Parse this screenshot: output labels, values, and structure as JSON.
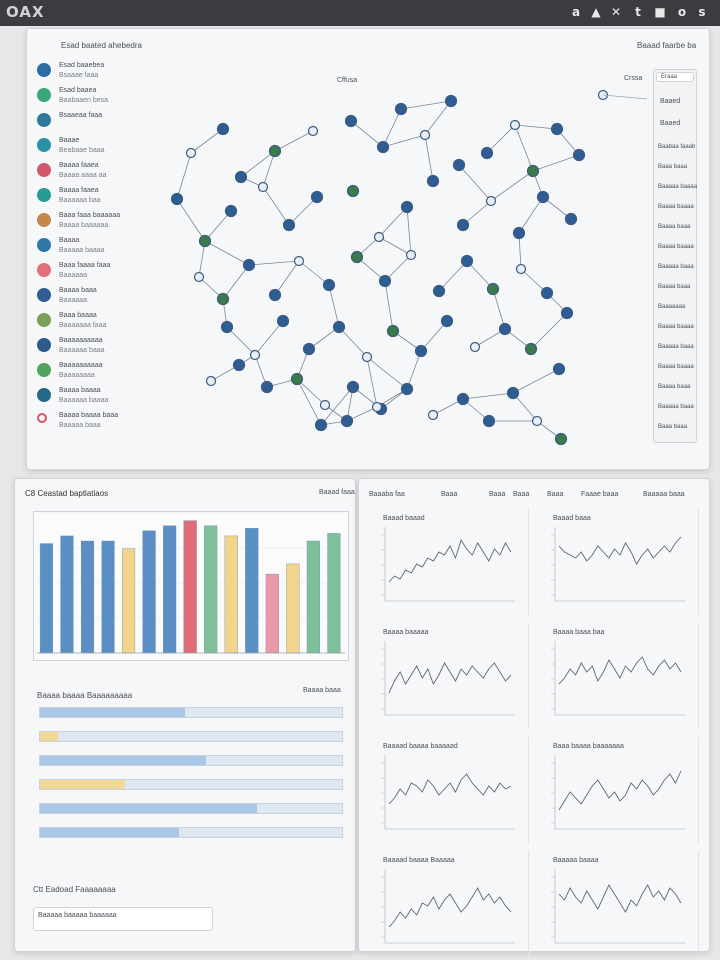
{
  "app": {
    "logo": "OAX",
    "toolbar_icons": [
      "a-icon",
      "pin-icon",
      "bolt-icon",
      "tree-icon",
      "square-icon",
      "circle-icon",
      "download-icon"
    ]
  },
  "network_panel": {
    "sidebar_title": "Esad baated ahebedra",
    "header_right": "Baaad faarbe ba",
    "graph_label": "Cffusa",
    "legend_items": [
      {
        "label": "Esad baaebea",
        "sub": "Bsaaae faaa",
        "color": "#2e6da4"
      },
      {
        "label": "Esad baaea",
        "sub": "Baabaaen besa",
        "color": "#3aa77a"
      },
      {
        "label": "Bsaaeaa faaa",
        "sub": "",
        "color": "#2e7a99"
      },
      {
        "label": "Baaae",
        "sub": "Beabaae baaa",
        "color": "#2a92a8"
      },
      {
        "label": "Baaaa faaea",
        "sub": "Baaaa aaaa aa",
        "color": "#d4566a"
      },
      {
        "label": "Baaaa faaea",
        "sub": "Baaaaaa baa",
        "color": "#2a9a94"
      },
      {
        "label": "Baaa faaa baaaaaa",
        "sub": "Baaaa baaaaaa",
        "color": "#c4884a"
      },
      {
        "label": "Baaaa",
        "sub": "Baaaaa baaaa",
        "color": "#2f78a8"
      },
      {
        "label": "Baaa faaaa faaa",
        "sub": "Baaaaaa",
        "color": "#e0707a"
      },
      {
        "label": "Baaaa baaa",
        "sub": "Baaaaaa",
        "color": "#2d5e94"
      },
      {
        "label": "Baaa baaaa",
        "sub": "Baaaaaaa faaa",
        "color": "#7aa05a"
      },
      {
        "label": "Baaaaaaaaaa",
        "sub": "Baaaaaa baaa",
        "color": "#2d5a8a"
      },
      {
        "label": "Baaaaaaaaaa",
        "sub": "Baaaaaaaa",
        "color": "#52a35e"
      },
      {
        "label": "Baaaa baaaa",
        "sub": "Baaaaaa baaaa",
        "color": "#24688a"
      },
      {
        "label": "Baaaa baaaa baaa",
        "sub": "Baaaaa baaa",
        "color": "#f4f4f4"
      }
    ],
    "right_panel": {
      "search_placeholder": "Eraaa",
      "title": "Crssa",
      "section1": "Baaed",
      "section2": "Baaed",
      "entries": [
        "Baabaa faaab",
        "Baaa baaa",
        "Baaaaa baaaa",
        "Baaaa baaaa",
        "Baaaa baaa",
        "Baaaa baaaa",
        "Baaaaa baaa",
        "Baaaa baaa",
        "Baaaaaaa",
        "Baaaa baaaa",
        "Baaaaa baaa",
        "Baaaa baaaa",
        "Baaaa baaa",
        "Baaaaa baaa",
        "Baaa baaa"
      ]
    }
  },
  "bar_panel": {
    "title": "C8 Ceastad baptlatiaos",
    "header_right": "Baaad faaa",
    "chart_data": {
      "type": "bar",
      "title": "",
      "categories": [
        "",
        "",
        "",
        "",
        "",
        "",
        "",
        "",
        "",
        "",
        "",
        "",
        "",
        "",
        ""
      ],
      "colors": [
        "#5a8fc4",
        "#5a8fc4",
        "#5a8fc4",
        "#5a8fc4",
        "#f2d48a",
        "#5a8fc4",
        "#5a8fc4",
        "#e06c78",
        "#7ec09a",
        "#f2d48a",
        "#5a8fc4",
        "#e89aa8",
        "#f2d48a",
        "#7ec09a",
        "#7ec09a"
      ],
      "values": [
        86,
        92,
        88,
        88,
        82,
        96,
        100,
        104,
        100,
        92,
        98,
        62,
        70,
        88,
        94
      ],
      "ylim": [
        0,
        110
      ]
    },
    "progress_title": "Baaaa baaaa Baaaaaaaaa",
    "progress_header_right": "Baaaa baaa",
    "progress_bars": [
      {
        "label": "",
        "fraction": 0.48,
        "color": "#a9c7e6"
      },
      {
        "label": "",
        "fraction": 0.06,
        "color": "#f3d998"
      },
      {
        "label": "",
        "fraction": 0.55,
        "color": "#a9c7e6"
      },
      {
        "label": "",
        "fraction": 0.28,
        "color": "#f3d998"
      },
      {
        "label": "",
        "fraction": 0.72,
        "color": "#a9c7e6"
      },
      {
        "label": "",
        "fraction": 0.46,
        "color": "#a9c7e6"
      }
    ],
    "footer_title": "Ctt Eadoad Faaaaaaaa",
    "footer_input": "Baaaaa baaaaa baaaaaa"
  },
  "line_panel": {
    "header": [
      "Baaaba faa",
      "Baaa",
      "Baaa",
      "Baaa",
      "Baaa",
      "Faaae baaa",
      "Baaaaa baaa"
    ],
    "charts": [
      {
        "title": "Baaad baaad",
        "values": [
          10,
          14,
          12,
          18,
          16,
          22,
          20,
          26,
          24,
          30,
          28,
          34,
          26,
          38,
          32,
          28,
          36,
          30,
          24,
          32,
          28,
          36,
          30
        ]
      },
      {
        "title": "Baaad baaa",
        "values": [
          34,
          30,
          28,
          26,
          30,
          24,
          28,
          34,
          30,
          26,
          32,
          28,
          36,
          30,
          22,
          28,
          32,
          26,
          30,
          34,
          30,
          36,
          40
        ]
      },
      {
        "title": "Baaaa baaaaa",
        "values": [
          12,
          20,
          26,
          18,
          24,
          30,
          22,
          28,
          18,
          24,
          32,
          26,
          20,
          28,
          24,
          30,
          26,
          22,
          28,
          32,
          26,
          20,
          24
        ]
      },
      {
        "title": "Baaaa baaa baa",
        "values": [
          18,
          22,
          28,
          24,
          32,
          26,
          30,
          20,
          26,
          34,
          28,
          22,
          30,
          26,
          32,
          36,
          28,
          24,
          30,
          34,
          28,
          32,
          26
        ]
      },
      {
        "title": "Baaaad baaaa baaaaad",
        "values": [
          14,
          18,
          24,
          20,
          28,
          26,
          22,
          30,
          26,
          20,
          24,
          28,
          22,
          30,
          34,
          28,
          24,
          20,
          26,
          22,
          28,
          24,
          26
        ]
      },
      {
        "title": "Baaa baaaa baaaaaaa",
        "values": [
          10,
          16,
          22,
          18,
          14,
          20,
          26,
          30,
          24,
          18,
          22,
          16,
          20,
          28,
          24,
          30,
          26,
          20,
          24,
          30,
          34,
          28,
          36
        ]
      },
      {
        "title": "Baaaad baaaa Baaaaa",
        "values": [
          8,
          12,
          18,
          14,
          20,
          16,
          24,
          22,
          28,
          20,
          26,
          30,
          24,
          18,
          22,
          28,
          34,
          26,
          30,
          24,
          28,
          22,
          18
        ]
      },
      {
        "title": "Baaaaa baaaa",
        "values": [
          30,
          26,
          34,
          28,
          24,
          32,
          26,
          20,
          28,
          36,
          30,
          24,
          18,
          26,
          22,
          30,
          36,
          28,
          32,
          26,
          34,
          30,
          24
        ]
      }
    ]
  }
}
